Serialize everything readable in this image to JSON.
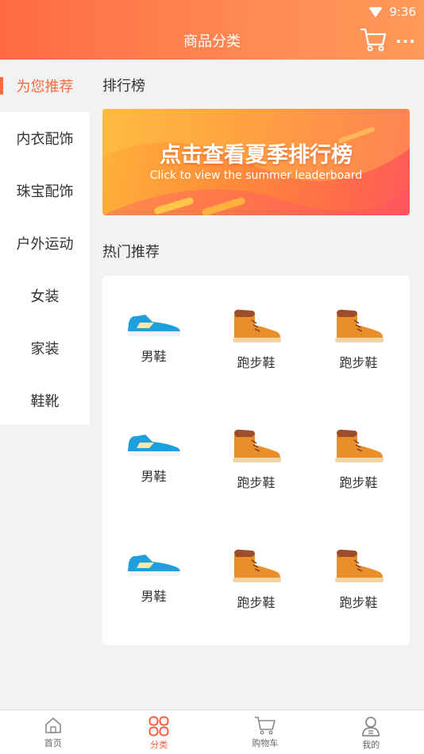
{
  "status_bar": {
    "time": "9:36"
  },
  "header": {
    "title": "商品分类"
  },
  "sidebar": {
    "items": [
      {
        "label": "为您推荐",
        "active": true
      },
      {
        "label": "内衣配饰"
      },
      {
        "label": "珠宝配饰"
      },
      {
        "label": "户外运动"
      },
      {
        "label": "女装"
      },
      {
        "label": "家装"
      },
      {
        "label": "鞋靴"
      }
    ]
  },
  "ranking": {
    "title": "排行榜",
    "banner_main": "点击查看夏季排行榜",
    "banner_sub": "Click to view the summer leaderboard"
  },
  "hot": {
    "title": "热门推荐",
    "products": [
      {
        "label": "男鞋",
        "icon": "sneaker-icon"
      },
      {
        "label": "跑步鞋",
        "icon": "boot-icon"
      },
      {
        "label": "跑步鞋",
        "icon": "boot-icon"
      },
      {
        "label": "男鞋",
        "icon": "sneaker-icon"
      },
      {
        "label": "跑步鞋",
        "icon": "boot-icon"
      },
      {
        "label": "跑步鞋",
        "icon": "boot-icon"
      },
      {
        "label": "男鞋",
        "icon": "sneaker-icon"
      },
      {
        "label": "跑步鞋",
        "icon": "boot-icon"
      },
      {
        "label": "跑步鞋",
        "icon": "boot-icon"
      }
    ]
  },
  "tabbar": {
    "tabs": [
      {
        "label": "首页",
        "icon": "home-icon"
      },
      {
        "label": "分类",
        "icon": "category-icon",
        "active": true
      },
      {
        "label": "购物车",
        "icon": "cart-icon"
      },
      {
        "label": "我的",
        "icon": "user-icon"
      }
    ]
  },
  "colors": {
    "accent": "#ff6a3c",
    "header_start": "#ff6a45",
    "header_end": "#ff9a5a"
  }
}
